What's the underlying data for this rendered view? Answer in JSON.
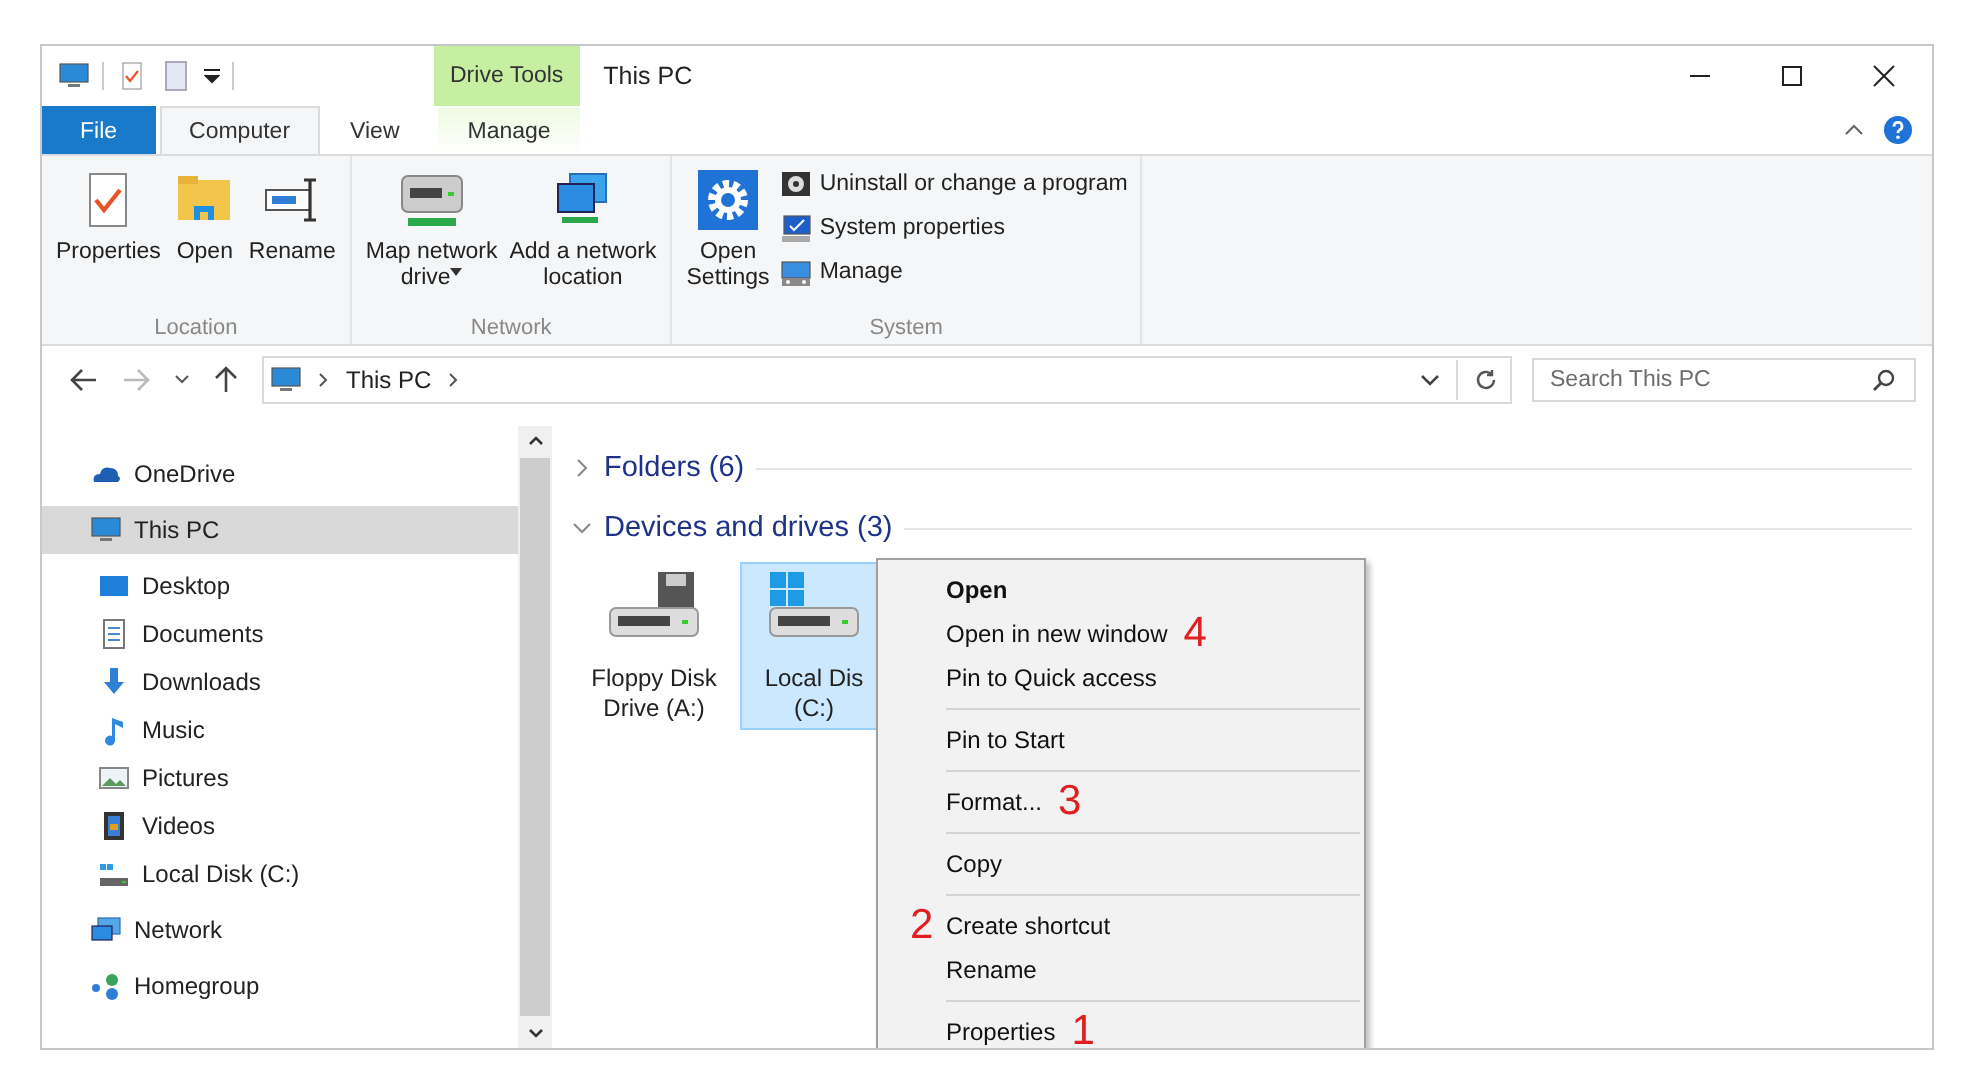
{
  "window": {
    "title": "This PC"
  },
  "contextual_tab_group": {
    "label": "Drive Tools"
  },
  "ribbon_tabs": [
    {
      "label": "File",
      "kind": "file",
      "selected": false
    },
    {
      "label": "Computer",
      "kind": "normal",
      "selected": true
    },
    {
      "label": "View",
      "kind": "normal",
      "selected": false
    },
    {
      "label": "Manage",
      "kind": "contextual",
      "selected": false
    }
  ],
  "ribbon_groups": [
    {
      "name": "Location",
      "commands": [
        {
          "kind": "large",
          "lines": [
            "Properties"
          ]
        },
        {
          "kind": "large",
          "lines": [
            "Open"
          ]
        },
        {
          "kind": "large",
          "lines": [
            "Rename"
          ]
        }
      ]
    },
    {
      "name": "Network",
      "commands": [
        {
          "kind": "large",
          "lines": [
            "Map network",
            "drive"
          ],
          "dropdown": true
        },
        {
          "kind": "large",
          "lines": [
            "Add a network",
            "location"
          ]
        }
      ]
    },
    {
      "name": "System",
      "commands": [
        {
          "kind": "large",
          "lines": [
            "Open",
            "Settings"
          ]
        },
        {
          "kind": "small",
          "lines": [
            "Uninstall or change a program"
          ]
        },
        {
          "kind": "small",
          "lines": [
            "System properties"
          ]
        },
        {
          "kind": "small",
          "lines": [
            "Manage"
          ]
        }
      ]
    }
  ],
  "address_bar": {
    "path": [
      "This PC"
    ]
  },
  "search": {
    "placeholder": "Search This PC"
  },
  "navigation": [
    {
      "label": "OneDrive",
      "selected": false
    },
    {
      "label": "This PC",
      "selected": true,
      "children": [
        {
          "label": "Desktop",
          "selected": false
        },
        {
          "label": "Documents",
          "selected": false
        },
        {
          "label": "Downloads",
          "selected": false
        },
        {
          "label": "Music",
          "selected": false
        },
        {
          "label": "Pictures",
          "selected": false
        },
        {
          "label": "Videos",
          "selected": false
        },
        {
          "label": "Local Disk (C:)",
          "selected": false
        }
      ]
    },
    {
      "label": "Network",
      "selected": false
    },
    {
      "label": "Homegroup",
      "selected": false
    }
  ],
  "sections": [
    {
      "title": "Folders (6)",
      "expanded": false
    },
    {
      "title": "Devices and drives (3)",
      "expanded": true,
      "items": [
        {
          "lines": [
            "Floppy Disk",
            "Drive (A:)"
          ],
          "selected": false
        },
        {
          "lines": [
            "Local Dis",
            "(C:)"
          ],
          "selected": true
        }
      ]
    }
  ],
  "context_menu": {
    "groups": [
      [
        {
          "label": "Open",
          "default": true
        },
        {
          "label": "Open in new window",
          "default": false,
          "annotation_after": "4"
        },
        {
          "label": "Pin to Quick access",
          "default": false
        }
      ],
      [
        {
          "label": "Pin to Start",
          "default": false
        }
      ],
      [
        {
          "label": "Format...",
          "default": false,
          "annotation_after": "3"
        }
      ],
      [
        {
          "label": "Copy",
          "default": false
        }
      ],
      [
        {
          "label": "Create shortcut",
          "default": false,
          "annotation_before": "2"
        },
        {
          "label": "Rename",
          "default": false
        }
      ],
      [
        {
          "label": "Properties",
          "default": false,
          "annotation_after": "1"
        }
      ]
    ]
  }
}
